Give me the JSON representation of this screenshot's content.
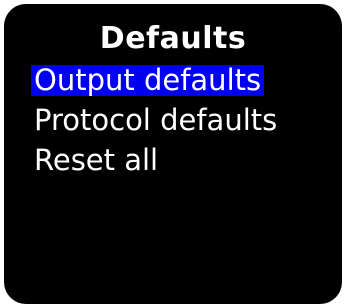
{
  "header": {
    "title": "Defaults"
  },
  "menu": {
    "items": [
      {
        "label": "Output defaults",
        "selected": true
      },
      {
        "label": "Protocol defaults",
        "selected": false
      },
      {
        "label": "Reset all",
        "selected": false
      }
    ]
  },
  "colors": {
    "screen_background": "#000000",
    "text": "#ffffff",
    "selection_highlight": "#0000ee",
    "page_background": "#ffffff"
  }
}
